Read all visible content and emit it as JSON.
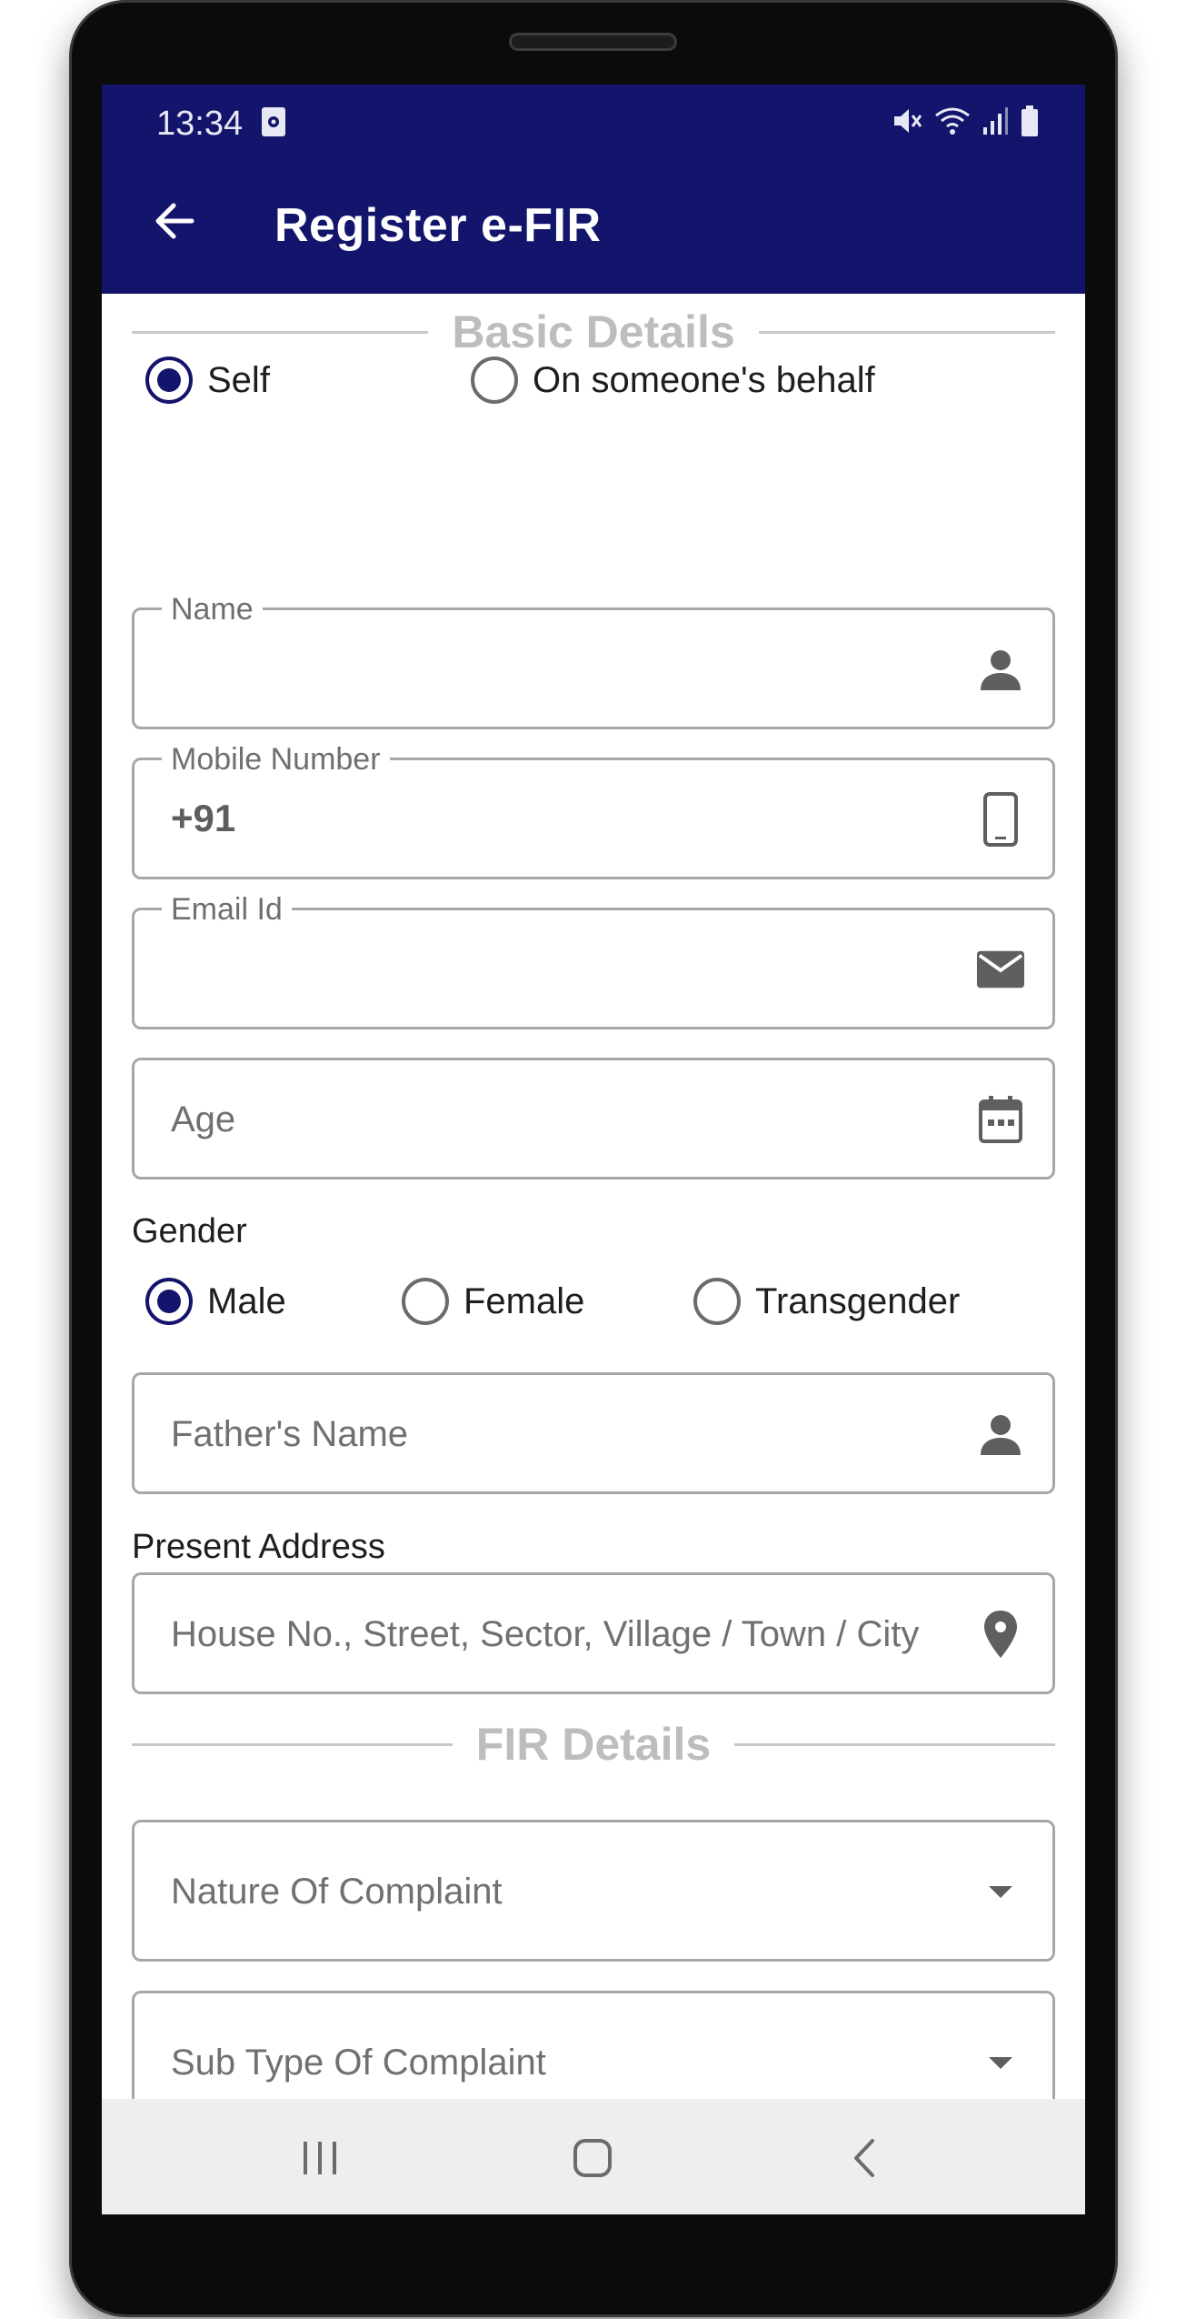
{
  "status_bar": {
    "time": "13:34",
    "icons": [
      "media-icon",
      "mute-icon",
      "wifi-icon",
      "signal-icon",
      "battery-icon"
    ]
  },
  "app_bar": {
    "title": "Register e-FIR",
    "back_icon": "arrow-left-icon",
    "background": "#13146b"
  },
  "basic_details": {
    "heading": "Basic Details",
    "complainant_options": [
      {
        "label": "Self",
        "selected": true
      },
      {
        "label": "On someone's behalf",
        "selected": false
      }
    ],
    "name_field": {
      "label": "Name",
      "value": "",
      "icon": "person-icon"
    },
    "mobile_field": {
      "label": "Mobile Number",
      "value": "+91",
      "icon": "phone-icon"
    },
    "email_field": {
      "label": "Email Id",
      "value": "",
      "icon": "mail-icon"
    },
    "age_field": {
      "placeholder": "Age",
      "icon": "calendar-icon"
    },
    "gender_label": "Gender",
    "gender_options": [
      {
        "label": "Male",
        "selected": true
      },
      {
        "label": "Female",
        "selected": false
      },
      {
        "label": "Transgender",
        "selected": false
      }
    ],
    "father_field": {
      "placeholder": "Father's Name",
      "icon": "person-icon"
    },
    "address_label": "Present Address",
    "address_field": {
      "placeholder": "House No., Street, Sector, Village / Town / City",
      "icon": "location-pin-icon"
    }
  },
  "fir_details": {
    "heading": "FIR Details",
    "nature_select": {
      "placeholder": "Nature Of Complaint",
      "icon": "dropdown-arrow-icon"
    },
    "subtype_select": {
      "placeholder": "Sub Type Of Complaint",
      "icon": "dropdown-arrow-icon"
    }
  },
  "nav_bar": {
    "buttons": [
      "recents-icon",
      "home-icon",
      "back-icon"
    ]
  },
  "colors": {
    "primary": "#13146b",
    "section_heading": "#bdbdbd",
    "field_border": "#a7a7a7"
  }
}
